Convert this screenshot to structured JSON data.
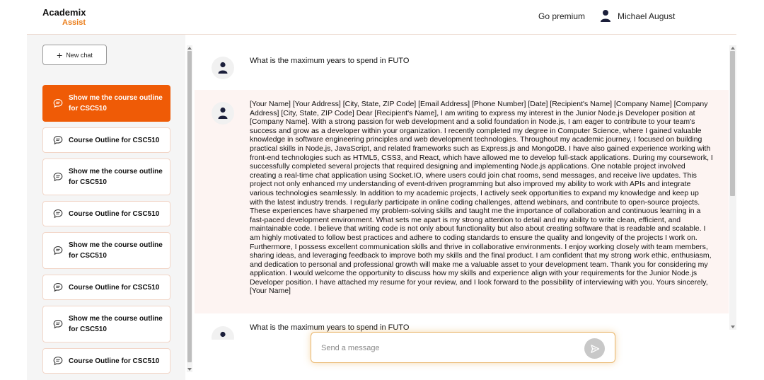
{
  "brand": {
    "name": "Academix",
    "sub": "Assist"
  },
  "header": {
    "go_premium": "Go premium",
    "user_name": "Michael August",
    "user_icon": "user-icon"
  },
  "sidebar": {
    "new_chat": "New chat",
    "items": [
      {
        "label": "Show me the course outline for CSC510",
        "active": true
      },
      {
        "label": "Course Outline for CSC510"
      },
      {
        "label": "Show me the course outline for CSC510"
      },
      {
        "label": "Course Outline for CSC510"
      },
      {
        "label": "Show me the course outline for CSC510"
      },
      {
        "label": "Course Outline for CSC510"
      },
      {
        "label": "Show me the course outline for CSC510"
      },
      {
        "label": "Course Outline for CSC510"
      }
    ]
  },
  "chat": {
    "messages": [
      {
        "text": "What is the maximum years to spend in FUTO"
      },
      {
        "text": "[Your Name] [Your Address] [City, State, ZIP Code] [Email Address] [Phone Number] [Date] [Recipient's Name] [Company Name] [Company Address] [City, State, ZIP Code] Dear [Recipient's Name], I am writing to express my interest in the Junior Node.js Developer position at [Company Name]. With a strong passion for web development and a solid foundation in Node.js, I am eager to contribute to your team's success and grow as a developer within your organization. I recently completed my degree in Computer Science, where I gained valuable knowledge in software engineering principles and web development technologies. Throughout my academic journey, I focused on building practical skills in Node.js, JavaScript, and related frameworks such as Express.js and MongoDB. I have also gained experience working with front-end technologies such as HTML5, CSS3, and React, which have allowed me to develop full-stack applications. During my coursework, I successfully completed several projects that required designing and implementing Node.js applications. One notable project involved creating a real-time chat application using Socket.IO, where users could join chat rooms, send messages, and receive live updates. This project not only enhanced my understanding of event-driven programming but also improved my ability to work with APIs and integrate various technologies seamlessly. In addition to my academic projects, I actively seek opportunities to expand my knowledge and keep up with the latest industry trends. I regularly participate in online coding challenges, attend webinars, and contribute to open-source projects. These experiences have sharpened my problem-solving skills and taught me the importance of collaboration and continuous learning in a fast-paced development environment. What sets me apart is my strong attention to detail and my ability to write clean, efficient, and maintainable code. I believe that writing code is not only about functionality but also about creating software that is readable and scalable. I am highly motivated to follow best practices and adhere to coding standards to ensure the quality and longevity of the projects I work on. Furthermore, I possess excellent communication skills and thrive in collaborative environments. I enjoy working closely with team members, sharing ideas, and leveraging feedback to improve both my skills and the final product. I am confident that my strong work ethic, enthusiasm, and dedication to personal and professional growth will make me a valuable asset to your development team. Thank you for considering my application. I would welcome the opportunity to discuss how my skills and experience align with your requirements for the Junior Node.js Developer position. I have attached my resume for your review, and I look forward to the possibility of interviewing with you. Yours sincerely, [Your Name]"
      },
      {
        "text": "What is the maximum years to spend in FUTO"
      }
    ]
  },
  "composer": {
    "placeholder": "Send a message",
    "send_icon": "send-icon"
  },
  "colors": {
    "accent": "#ef5b06",
    "brand_sub": "#ea7a14",
    "answer_bg": "#fdf4f2"
  }
}
